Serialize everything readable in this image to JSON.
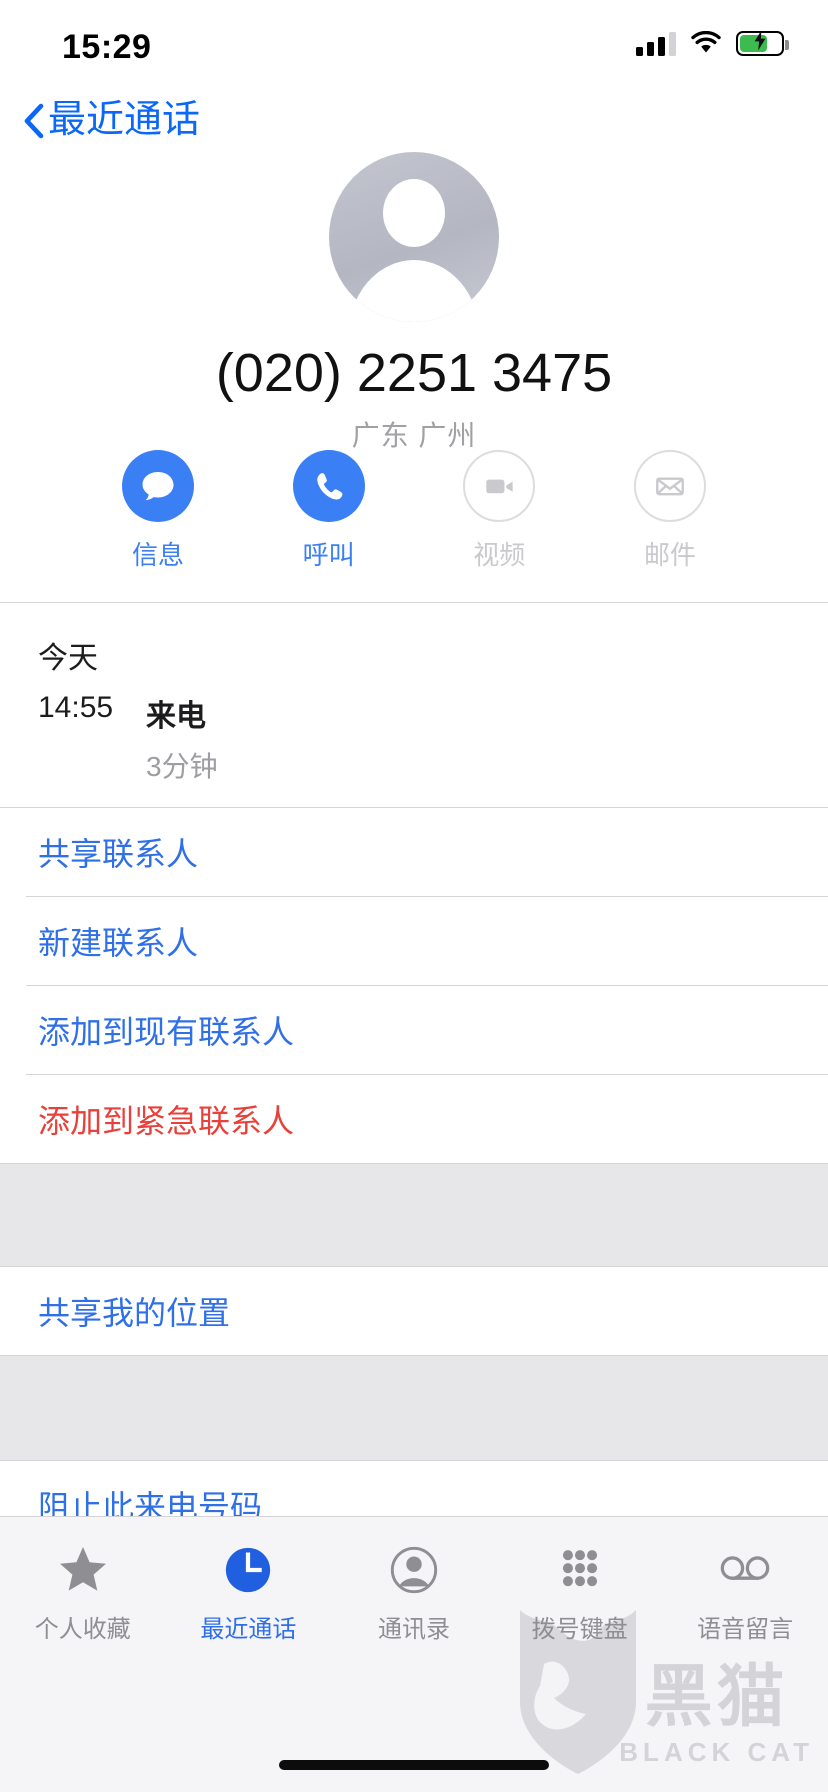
{
  "status_bar": {
    "time": "15:29",
    "signal_icon": "cellular-bars-icon",
    "wifi_icon": "wifi-icon",
    "battery_icon": "battery-charging-icon",
    "battery_level_percent": 62
  },
  "nav": {
    "back_icon": "chevron-left-icon",
    "back_label": "最近通话"
  },
  "contact": {
    "avatar_icon": "person-placeholder-avatar",
    "phone_number": "(020) 2251 3475",
    "location": "广东 广州"
  },
  "actions": [
    {
      "label": "信息",
      "icon": "message-bubble-icon",
      "enabled": true
    },
    {
      "label": "呼叫",
      "icon": "phone-handset-icon",
      "enabled": true
    },
    {
      "label": "视频",
      "icon": "video-camera-icon",
      "enabled": false
    },
    {
      "label": "邮件",
      "icon": "envelope-icon",
      "enabled": false
    }
  ],
  "call_history": {
    "section_title": "今天",
    "entries": [
      {
        "time": "14:55",
        "type": "来电",
        "duration": "3分钟"
      }
    ]
  },
  "menu_sections": [
    {
      "items": [
        {
          "label": "共享联系人",
          "style": "blue"
        },
        {
          "label": "新建联系人",
          "style": "blue"
        },
        {
          "label": "添加到现有联系人",
          "style": "blue"
        },
        {
          "label": "添加到紧急联系人",
          "style": "red"
        }
      ]
    },
    {
      "items": [
        {
          "label": "共享我的位置",
          "style": "blue"
        }
      ]
    },
    {
      "items": [
        {
          "label": "阻止此来电号码",
          "style": "blue"
        }
      ]
    }
  ],
  "tabbar": [
    {
      "label": "个人收藏",
      "icon": "star-icon",
      "active": false
    },
    {
      "label": "最近通话",
      "icon": "clock-icon",
      "active": true
    },
    {
      "label": "通讯录",
      "icon": "contacts-icon",
      "active": false
    },
    {
      "label": "拨号键盘",
      "icon": "keypad-icon",
      "active": false
    },
    {
      "label": "语音留言",
      "icon": "voicemail-icon",
      "active": false
    }
  ],
  "watermark": {
    "chinese": "黑猫",
    "english": "BLACK CAT",
    "shield_icon": "black-cat-shield-icon"
  },
  "colors": {
    "accent_blue": "#2f6fe8",
    "action_blue": "#3b7ff5",
    "destructive_red": "#e8403a",
    "disabled_gray": "#c9c9ce",
    "group_gap": "#e7e7ea"
  }
}
